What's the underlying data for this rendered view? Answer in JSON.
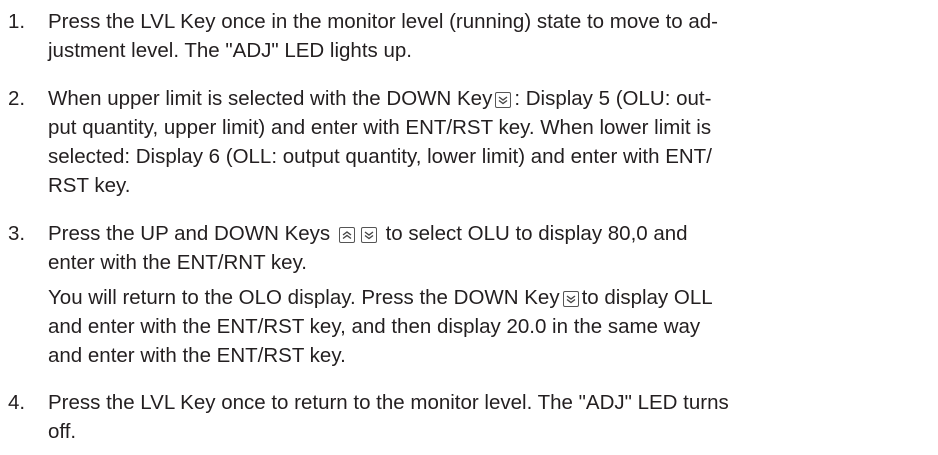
{
  "steps": [
    {
      "num": "1.",
      "lines": [
        "Press the LVL Key once in the monitor level (running) state to move to ad-",
        "justment level. The \"ADJ\" LED lights up."
      ]
    },
    {
      "num": "2.",
      "lines": [
        "When upper limit is selected with the DOWN Key",
        ": Display 5 (OLU: out-",
        "put quantity, upper limit) and enter with ENT/RST key. When lower limit is",
        "selected: Display 6 (OLL: output quantity, lower limit) and enter with ENT/",
        "RST key."
      ]
    },
    {
      "num": "3.",
      "lines": [
        "Press the UP and DOWN Keys",
        "to select OLU to display 80,0 and",
        "enter with the ENT/RNT key.",
        "You will return to the OLO display. Press the DOWN Key",
        "to display OLL",
        "and enter with the ENT/RST key, and then display 20.0 in the same way",
        "and enter with the ENT/RST key."
      ]
    },
    {
      "num": "4.",
      "lines": [
        "Press the LVL Key once to return to the monitor level. The \"ADJ\" LED turns",
        "off."
      ]
    }
  ]
}
